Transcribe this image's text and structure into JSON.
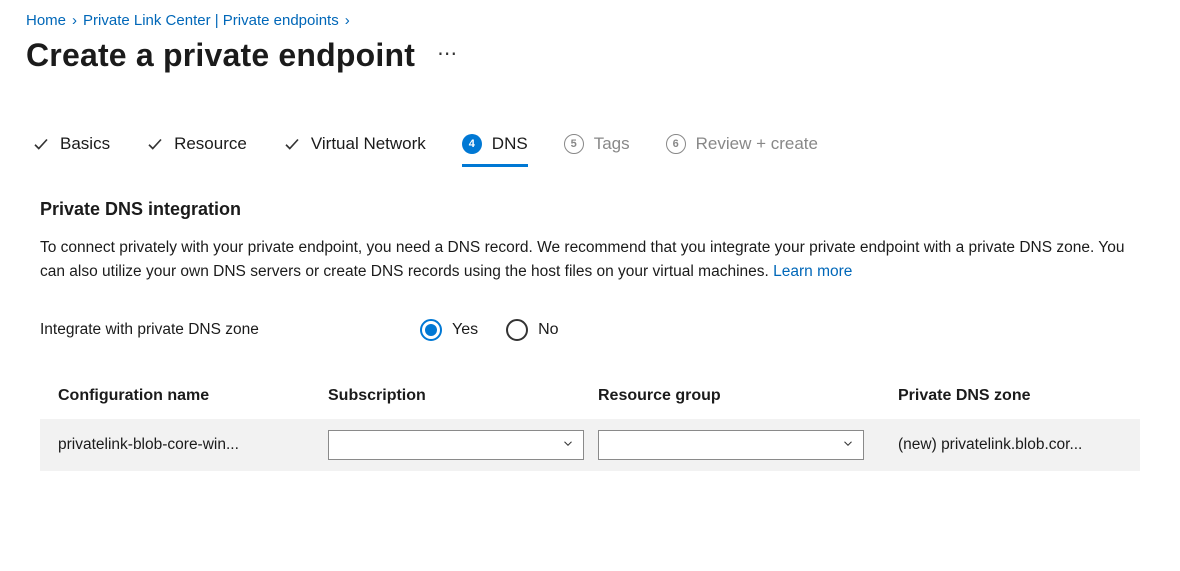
{
  "breadcrumb": {
    "home": "Home",
    "middle": "Private Link Center | Private endpoints"
  },
  "page_title": "Create a private endpoint",
  "steps": {
    "basics": "Basics",
    "resource": "Resource",
    "vnet": "Virtual Network",
    "dns_num": "4",
    "dns": "DNS",
    "tags_num": "5",
    "tags": "Tags",
    "review_num": "6",
    "review": "Review + create"
  },
  "section": {
    "title": "Private DNS integration",
    "description": "To connect privately with your private endpoint, you need a DNS record. We recommend that you integrate your private endpoint with a private DNS zone. You can also utilize your own DNS servers or create DNS records using the host files on your virtual machines.  ",
    "learn_more": "Learn more"
  },
  "integrate": {
    "label": "Integrate with private DNS zone",
    "yes": "Yes",
    "no": "No"
  },
  "table": {
    "headers": {
      "config": "Configuration name",
      "subscription": "Subscription",
      "rg": "Resource group",
      "zone": "Private DNS zone"
    },
    "row": {
      "config_name": "privatelink-blob-core-win...",
      "subscription_value": "",
      "rg_value": "",
      "zone_value": "(new) privatelink.blob.cor..."
    }
  }
}
